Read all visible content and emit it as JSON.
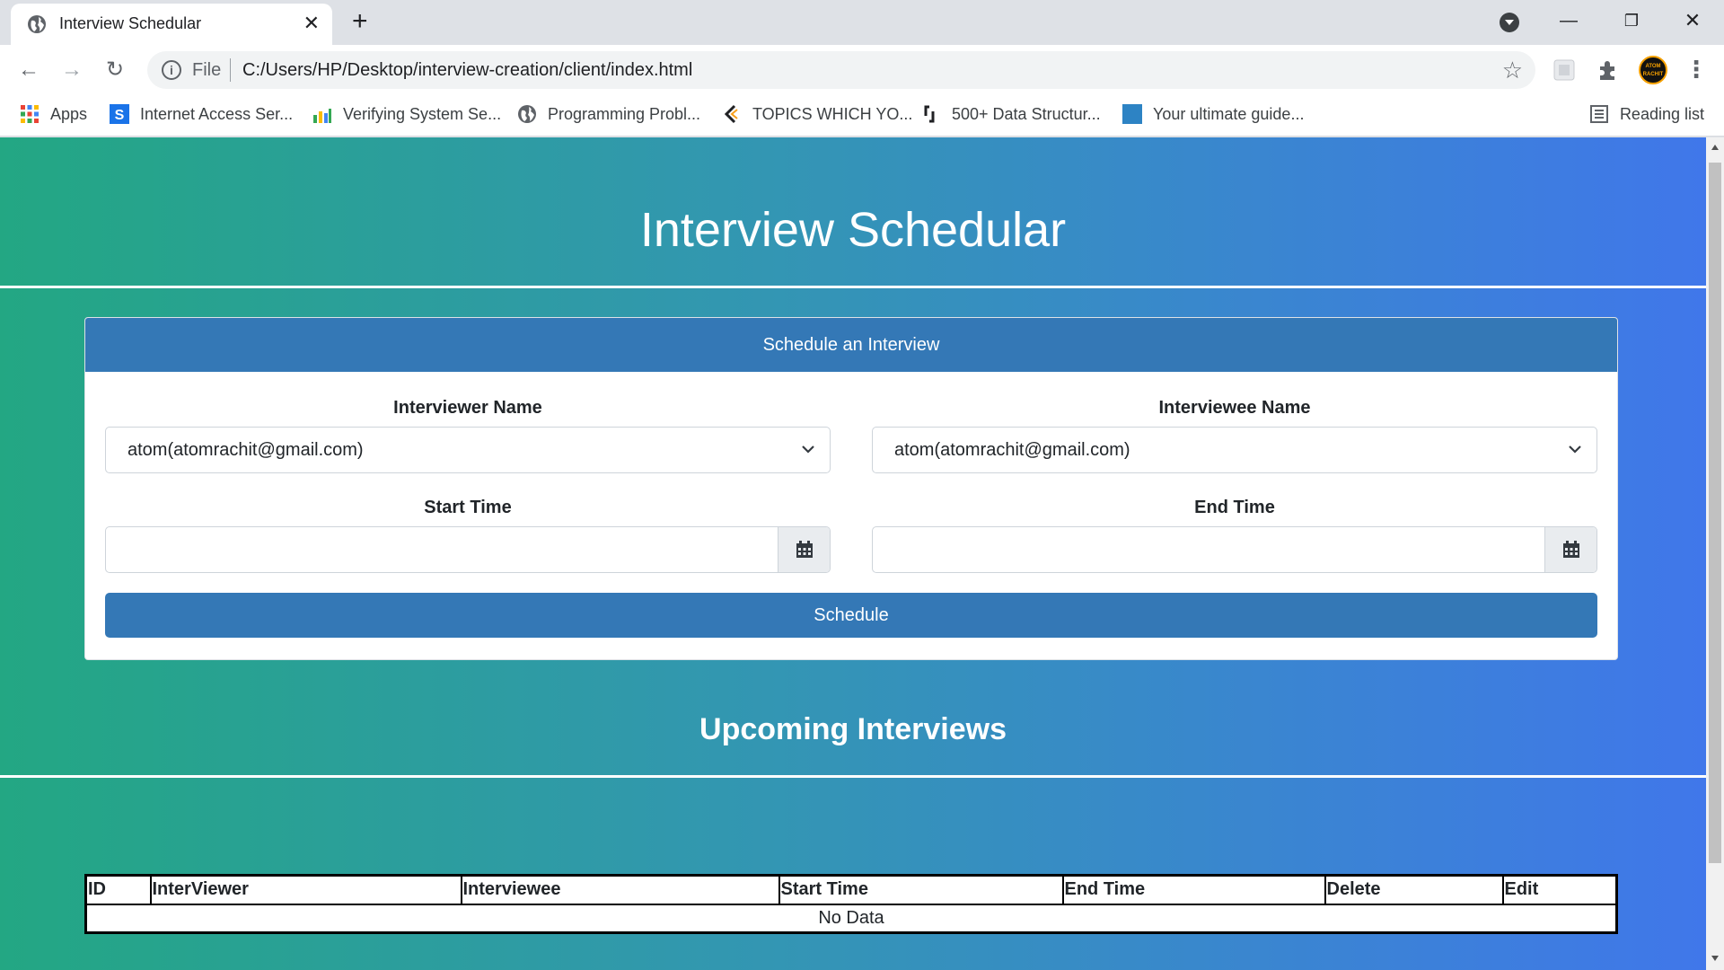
{
  "browser": {
    "tab_title": "Interview Schedular",
    "url_scheme_label": "File",
    "url": "C:/Users/HP/Desktop/interview-creation/client/index.html",
    "avatar_text": "ATOM RACHIT",
    "bookmarks": [
      {
        "label": "Apps",
        "icon": "apps-grid-icon"
      },
      {
        "label": "Internet Access Ser...",
        "icon": "s-logo-icon"
      },
      {
        "label": "Verifying System Se...",
        "icon": "bar-chart-icon"
      },
      {
        "label": "Programming Probl...",
        "icon": "globe-icon"
      },
      {
        "label": "TOPICS WHICH YO...",
        "icon": "code-logo-icon"
      },
      {
        "label": "500+ Data Structur...",
        "icon": "bracket-logo-icon"
      },
      {
        "label": "Your ultimate guide...",
        "icon": "blue-square-icon"
      }
    ],
    "reading_list": "Reading list"
  },
  "page": {
    "title": "Interview Schedular",
    "card": {
      "header": "Schedule an Interview",
      "interviewer_label": "Interviewer Name",
      "interviewer_value": "atom(atomrachit@gmail.com)",
      "interviewee_label": "Interviewee Name",
      "interviewee_value": "atom(atomrachit@gmail.com)",
      "start_label": "Start Time",
      "end_label": "End Time",
      "schedule_button": "Schedule"
    },
    "upcoming_title": "Upcoming Interviews",
    "table": {
      "headers": [
        "ID",
        "InterViewer",
        "Interviewee",
        "Start Time",
        "End Time",
        "Delete",
        "Edit"
      ],
      "empty_text": "No Data"
    }
  },
  "colors": {
    "primary": "#3478b6",
    "gradient_start": "#23a783",
    "gradient_end": "#4077ea"
  }
}
